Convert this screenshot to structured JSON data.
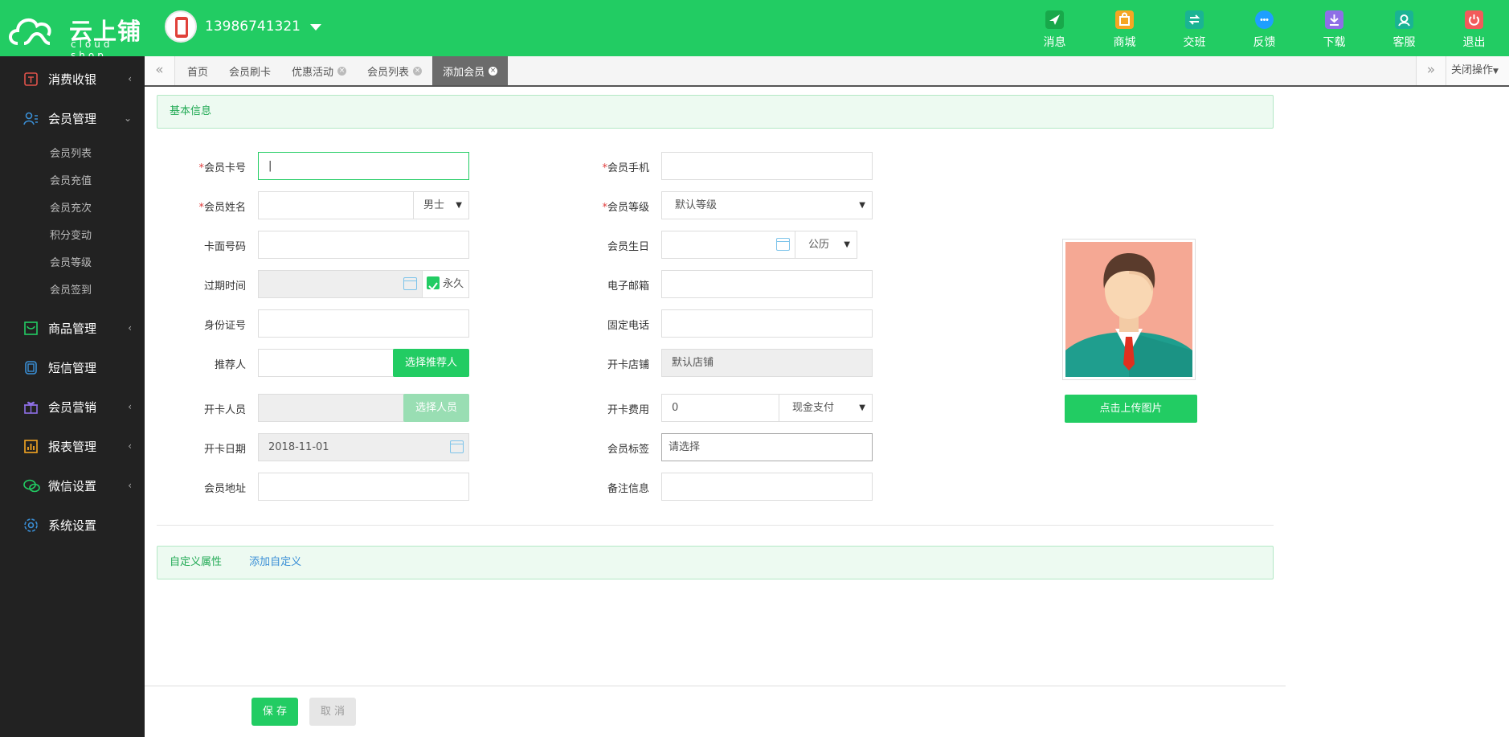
{
  "app": {
    "name_cn": "云上铺",
    "name_en": "cloud shop",
    "account": "13986741321"
  },
  "topnav": [
    {
      "label": "消息",
      "icon": "message-icon",
      "color": "#18a84a"
    },
    {
      "label": "商城",
      "icon": "shop-icon",
      "color": "#f5a623"
    },
    {
      "label": "交班",
      "icon": "shift-icon",
      "color": "#1ab394"
    },
    {
      "label": "反馈",
      "icon": "feedback-icon",
      "color": "#1e9fff"
    },
    {
      "label": "下载",
      "icon": "download-icon",
      "color": "#8e6fe6"
    },
    {
      "label": "客服",
      "icon": "service-icon",
      "color": "#1ab394"
    },
    {
      "label": "退出",
      "icon": "logout-icon",
      "color": "#f25b5b"
    }
  ],
  "sidebar": {
    "items": [
      {
        "label": "消费收银",
        "icon": "cashier-icon"
      },
      {
        "label": "会员管理",
        "icon": "member-icon"
      },
      {
        "label": "商品管理",
        "icon": "goods-icon"
      },
      {
        "label": "短信管理",
        "icon": "sms-icon"
      },
      {
        "label": "会员营销",
        "icon": "gift-icon"
      },
      {
        "label": "报表管理",
        "icon": "report-icon"
      },
      {
        "label": "微信设置",
        "icon": "wechat-icon"
      },
      {
        "label": "系统设置",
        "icon": "settings-icon"
      }
    ],
    "member_sub": [
      "会员列表",
      "会员充值",
      "会员充次",
      "积分变动",
      "会员等级",
      "会员签到"
    ]
  },
  "tabs": {
    "items": [
      "首页",
      "会员刷卡",
      "优惠活动",
      "会员列表",
      "添加会员"
    ],
    "close_ops": "关闭操作"
  },
  "form": {
    "section_basic": "基本信息",
    "card_no": {
      "label": "会员卡号",
      "value": ""
    },
    "phone": {
      "label": "会员手机",
      "value": ""
    },
    "name": {
      "label": "会员姓名",
      "value": "",
      "gender": "男士"
    },
    "level": {
      "label": "会员等级",
      "value": "默认等级"
    },
    "card_face": {
      "label": "卡面号码",
      "value": ""
    },
    "birthday": {
      "label": "会员生日",
      "value": "",
      "calendar": "公历"
    },
    "expire": {
      "label": "过期时间",
      "value": "",
      "forever_label": "永久",
      "forever_checked": true
    },
    "email": {
      "label": "电子邮箱",
      "value": ""
    },
    "id_card": {
      "label": "身份证号",
      "value": ""
    },
    "landline": {
      "label": "固定电话",
      "value": ""
    },
    "referrer": {
      "label": "推荐人",
      "value": "",
      "button": "选择推荐人"
    },
    "store": {
      "label": "开卡店铺",
      "value": "默认店铺"
    },
    "staff": {
      "label": "开卡人员",
      "value": "",
      "button": "选择人员"
    },
    "fee": {
      "label": "开卡费用",
      "value": "0",
      "pay": "现金支付"
    },
    "open_date": {
      "label": "开卡日期",
      "value": "2018-11-01"
    },
    "tags": {
      "label": "会员标签",
      "placeholder": "请选择"
    },
    "address": {
      "label": "会员地址",
      "value": ""
    },
    "remark": {
      "label": "备注信息",
      "value": ""
    },
    "upload_button": "点击上传图片",
    "section_custom": "自定义属性",
    "add_custom": "添加自定义"
  },
  "footer": {
    "save": "保 存",
    "cancel": "取 消"
  }
}
